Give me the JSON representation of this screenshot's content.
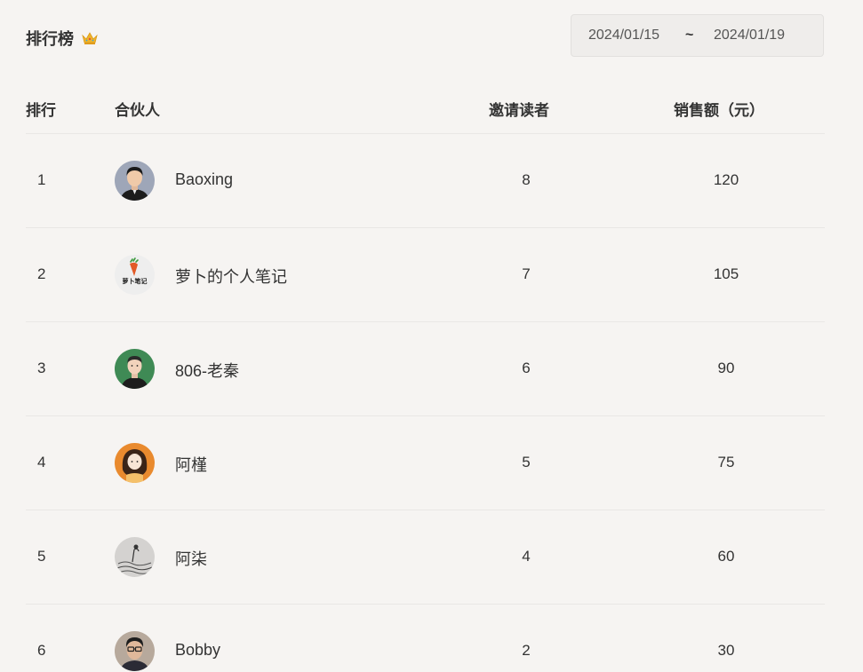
{
  "header": {
    "title": "排行榜",
    "crown_icon": "crown-icon",
    "date_start": "2024/01/15",
    "date_separator": "~",
    "date_end": "2024/01/19"
  },
  "table": {
    "columns": {
      "rank": "排行",
      "partner": "合伙人",
      "invite": "邀请读者",
      "sales": "销售额（元）"
    },
    "rows": [
      {
        "rank": "1",
        "name": "Baoxing",
        "invite": "8",
        "sales": "120",
        "avatar": "avatar-man-black-shirt"
      },
      {
        "rank": "2",
        "name": "萝卜的个人笔记",
        "invite": "7",
        "sales": "105",
        "avatar": "avatar-carrot-logo",
        "avatar_text": "萝卜笔记"
      },
      {
        "rank": "3",
        "name": "806-老秦",
        "invite": "6",
        "sales": "90",
        "avatar": "avatar-man-green-bg"
      },
      {
        "rank": "4",
        "name": "阿槿",
        "invite": "5",
        "sales": "75",
        "avatar": "avatar-girl-orange-bg"
      },
      {
        "rank": "5",
        "name": "阿柒",
        "invite": "4",
        "sales": "60",
        "avatar": "avatar-sketch-gray"
      },
      {
        "rank": "6",
        "name": "Bobby",
        "invite": "2",
        "sales": "30",
        "avatar": "avatar-man-glasses"
      }
    ]
  },
  "colors": {
    "background": "#f6f4f2",
    "text": "#333333",
    "divider": "#e9e7e5",
    "crown": "#f0b429"
  }
}
